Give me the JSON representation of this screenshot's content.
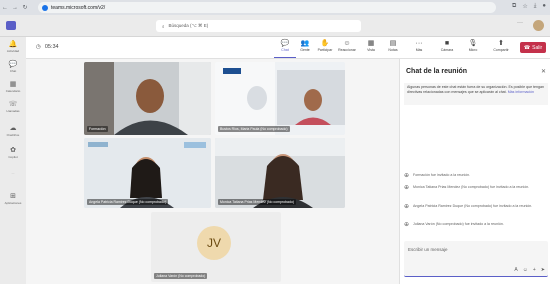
{
  "browser": {
    "url": "teams.microsoft.com/v2/"
  },
  "search": {
    "placeholder": "Búsqueda (⌥ ⌘ E)"
  },
  "rail": [
    {
      "icon": "bell-icon",
      "label": "Actividad"
    },
    {
      "icon": "chat-icon",
      "label": "Chat"
    },
    {
      "icon": "calendar-icon",
      "label": "Calendario"
    },
    {
      "icon": "phone-icon",
      "label": "Llamadas"
    },
    {
      "icon": "cloud-icon",
      "label": "OneDrive"
    },
    {
      "icon": "copilot-icon",
      "label": "Copilot"
    },
    {
      "icon": "more-icon",
      "label": "···"
    },
    {
      "icon": "apps-icon",
      "label": "Aplicaciones"
    }
  ],
  "meeting": {
    "timer": "05:34",
    "tools": [
      {
        "label": "Chat",
        "glyph": "💬"
      },
      {
        "label": "Gente",
        "glyph": "👥"
      },
      {
        "label": "Participar",
        "glyph": "✋"
      },
      {
        "label": "Reaccionar",
        "glyph": "☺"
      },
      {
        "label": "Vista",
        "glyph": "▦"
      },
      {
        "label": "Notas",
        "glyph": "▤"
      },
      {
        "label": "Más",
        "glyph": "···"
      },
      {
        "label": "Cámara",
        "glyph": "■"
      },
      {
        "label": "Micro",
        "glyph": "🎙"
      },
      {
        "label": "Compartir",
        "glyph": "⬆"
      }
    ],
    "leave_label": "Salir",
    "people_count": "6"
  },
  "tiles": {
    "formacion": "Formación",
    "bustos": "Bustos Rios, Maria Paula (No comprobado)",
    "angela": "Angela Patricia Ramirez Duque (No comprobado)",
    "monica": "Monica Tatiana Prias Mendez (No comprobado)",
    "juliana": "Juliana Varón (No comprobado)",
    "juliana_initials": "JV"
  },
  "chat": {
    "title": "Chat de la reunión",
    "notice": "Algunas personas de este chat están fuera de su organización. Es posible que tengan directivas relacionadas con mensajes que se aplicarán al chat.",
    "notice_link": "Más información",
    "messages": [
      "Formación fue invitado a la reunión.",
      "Monica Tatiana Prias Mendez (No comprobado) fue invitado a la reunión.",
      "Angela Patricia Ramirez Duque (No comprobado) fue invitado a la reunión.",
      "Juliana Varón (No comprobado) fue invitado a la reunión."
    ],
    "compose_placeholder": "Escribir un mensaje"
  }
}
